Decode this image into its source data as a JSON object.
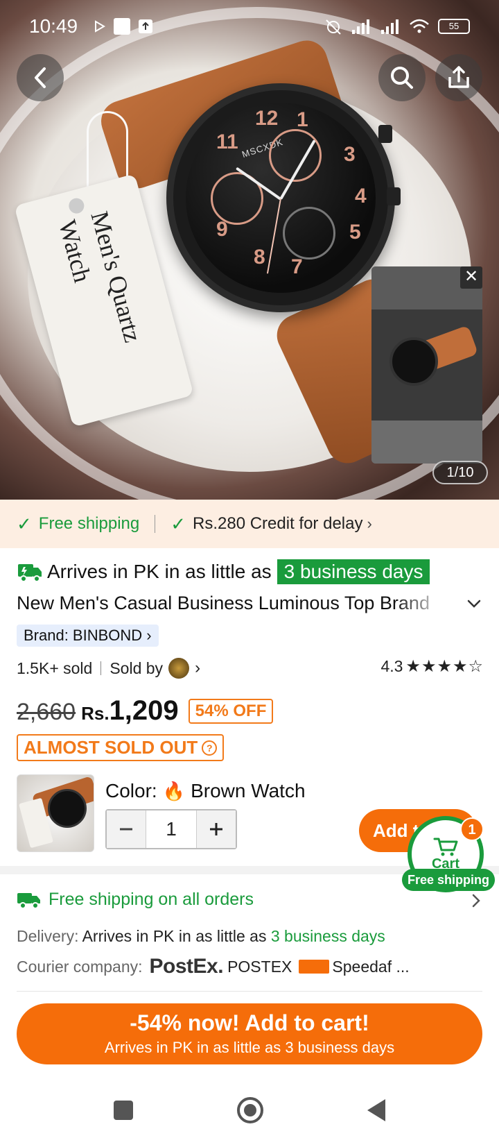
{
  "status_bar": {
    "time": "10:49",
    "battery": "55"
  },
  "hero": {
    "tag_text": "Men's Quartz Watch",
    "watch_brand": "MSCXDK",
    "dial_numbers": [
      "12",
      "1",
      "3",
      "4",
      "5",
      "7",
      "8",
      "9",
      "11"
    ],
    "counter": "1/10",
    "close_label": "✕"
  },
  "promo": {
    "free_shipping": "Free shipping",
    "credit": "Rs.280 Credit for delay"
  },
  "product": {
    "arrives_prefix": "Arrives in PK in as little as",
    "arrives_days": "3 business days",
    "title": "New Men's Casual Business Luminous Top Brand",
    "brand": "Brand: BINBOND",
    "sold": "1.5K+ sold",
    "sold_by": "Sold by",
    "rating": "4.3",
    "stars": "★★★★☆",
    "original_price": "2,660",
    "currency": "Rs.",
    "price": "1,209",
    "discount": "54% OFF",
    "almost_sold_out": "ALMOST SOLD OUT",
    "color_label": "Color:",
    "color_value": "Brown Watch",
    "quantity": "1",
    "add_button": "Add to cart"
  },
  "cart": {
    "label": "Cart",
    "badge": "1",
    "free_shipping": "Free shipping"
  },
  "shipping": {
    "headline": "Free shipping on all orders",
    "delivery_label": "Delivery:",
    "delivery_prefix": "Arrives in PK in as little as",
    "delivery_days": "3 business days",
    "courier_label": "Courier company:",
    "courier_logo": "PostEx.",
    "courier_1": "POSTEX",
    "courier_2": "Speedaf ..."
  },
  "cta": {
    "main": "-54% now! Add to cart!",
    "sub": "Arrives in PK in as little as 3 business days"
  },
  "colors": {
    "accent_orange": "#f56d0a",
    "green": "#1a9b3c",
    "promo_bg": "#fdeee2"
  }
}
